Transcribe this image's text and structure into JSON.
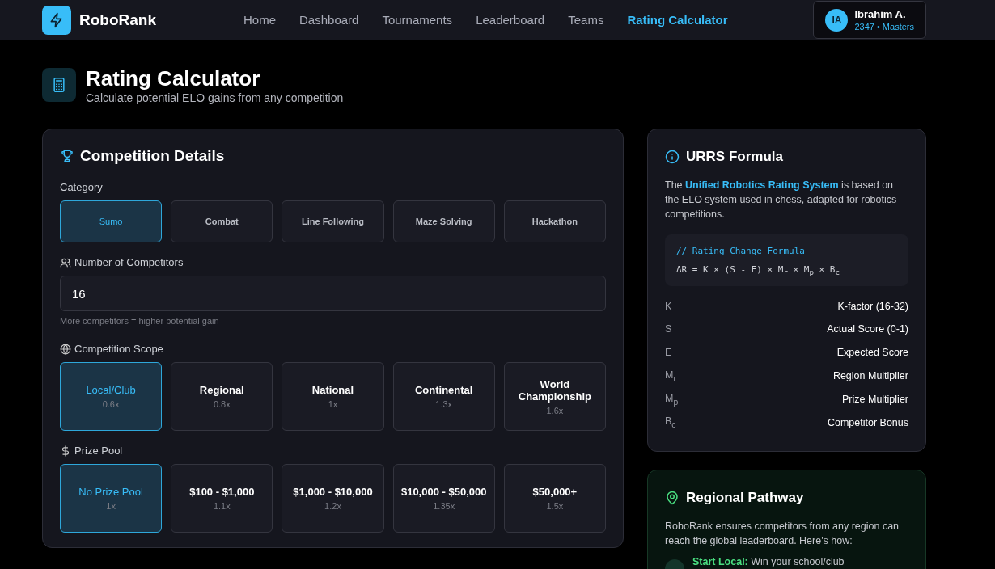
{
  "brand": {
    "name": "RoboRank"
  },
  "nav": [
    {
      "label": "Home",
      "selected": false
    },
    {
      "label": "Dashboard",
      "selected": false
    },
    {
      "label": "Tournaments",
      "selected": false
    },
    {
      "label": "Leaderboard",
      "selected": false
    },
    {
      "label": "Teams",
      "selected": false
    },
    {
      "label": "Rating Calculator",
      "selected": true
    }
  ],
  "user": {
    "initials": "IA",
    "name": "Ibrahim A.",
    "rating": "2347 • Masters"
  },
  "header": {
    "title": "Rating Calculator",
    "subtitle": "Calculate potential ELO gains from any competition"
  },
  "details": {
    "title": "Competition Details",
    "category": {
      "label": "Category",
      "options": [
        {
          "label": "Sumo",
          "selected": true
        },
        {
          "label": "Combat",
          "selected": false
        },
        {
          "label": "Line Following",
          "selected": false
        },
        {
          "label": "Maze Solving",
          "selected": false
        },
        {
          "label": "Hackathon",
          "selected": false
        }
      ]
    },
    "competitors": {
      "label": "Number of Competitors",
      "value": "16",
      "hint": "More competitors = higher potential gain"
    },
    "scope": {
      "label": "Competition Scope",
      "options": [
        {
          "label": "Local/Club",
          "multiplier": "0.6x",
          "selected": true
        },
        {
          "label": "Regional",
          "multiplier": "0.8x",
          "selected": false
        },
        {
          "label": "National",
          "multiplier": "1x",
          "selected": false
        },
        {
          "label": "Continental",
          "multiplier": "1.3x",
          "selected": false
        },
        {
          "label": "World Championship",
          "multiplier": "1.6x",
          "selected": false
        }
      ]
    },
    "prize": {
      "label": "Prize Pool",
      "options": [
        {
          "label": "No Prize Pool",
          "multiplier": "1x",
          "selected": true
        },
        {
          "label": "$100 - $1,000",
          "multiplier": "1.1x",
          "selected": false
        },
        {
          "label": "$1,000 - $10,000",
          "multiplier": "1.2x",
          "selected": false
        },
        {
          "label": "$10,000 - $50,000",
          "multiplier": "1.35x",
          "selected": false
        },
        {
          "label": "$50,000+",
          "multiplier": "1.5x",
          "selected": false
        }
      ]
    }
  },
  "formula": {
    "title": "URRS Formula",
    "description": "The **Unified Robotics Rating System** is based on the ELO system used in chess, adapted for robotics competitions.",
    "comment": "// Rating Change Formula",
    "equation": "ΔR = K × (S - E) × M$_{r}$ × M$_{p}$ × B$_{c}$",
    "variables": [
      {
        "symbol": "K",
        "meaning": "K-factor (16-32)"
      },
      {
        "symbol": "S",
        "meaning": "Actual Score (0-1)"
      },
      {
        "symbol": "E",
        "meaning": "Expected Score"
      },
      {
        "symbol": "M$_{r}$",
        "meaning": "Region Multiplier"
      },
      {
        "symbol": "M$_{p}$",
        "meaning": "Prize Multiplier"
      },
      {
        "symbol": "B$_{c}$",
        "meaning": "Competitor Bonus"
      }
    ]
  },
  "pathway": {
    "title": "Regional Pathway",
    "description": "RoboRank ensures competitors from any region can reach the global leaderboard. Here's how:",
    "steps": [
      {
        "text": "**Start Local:** Win your school/club"
      }
    ]
  }
}
